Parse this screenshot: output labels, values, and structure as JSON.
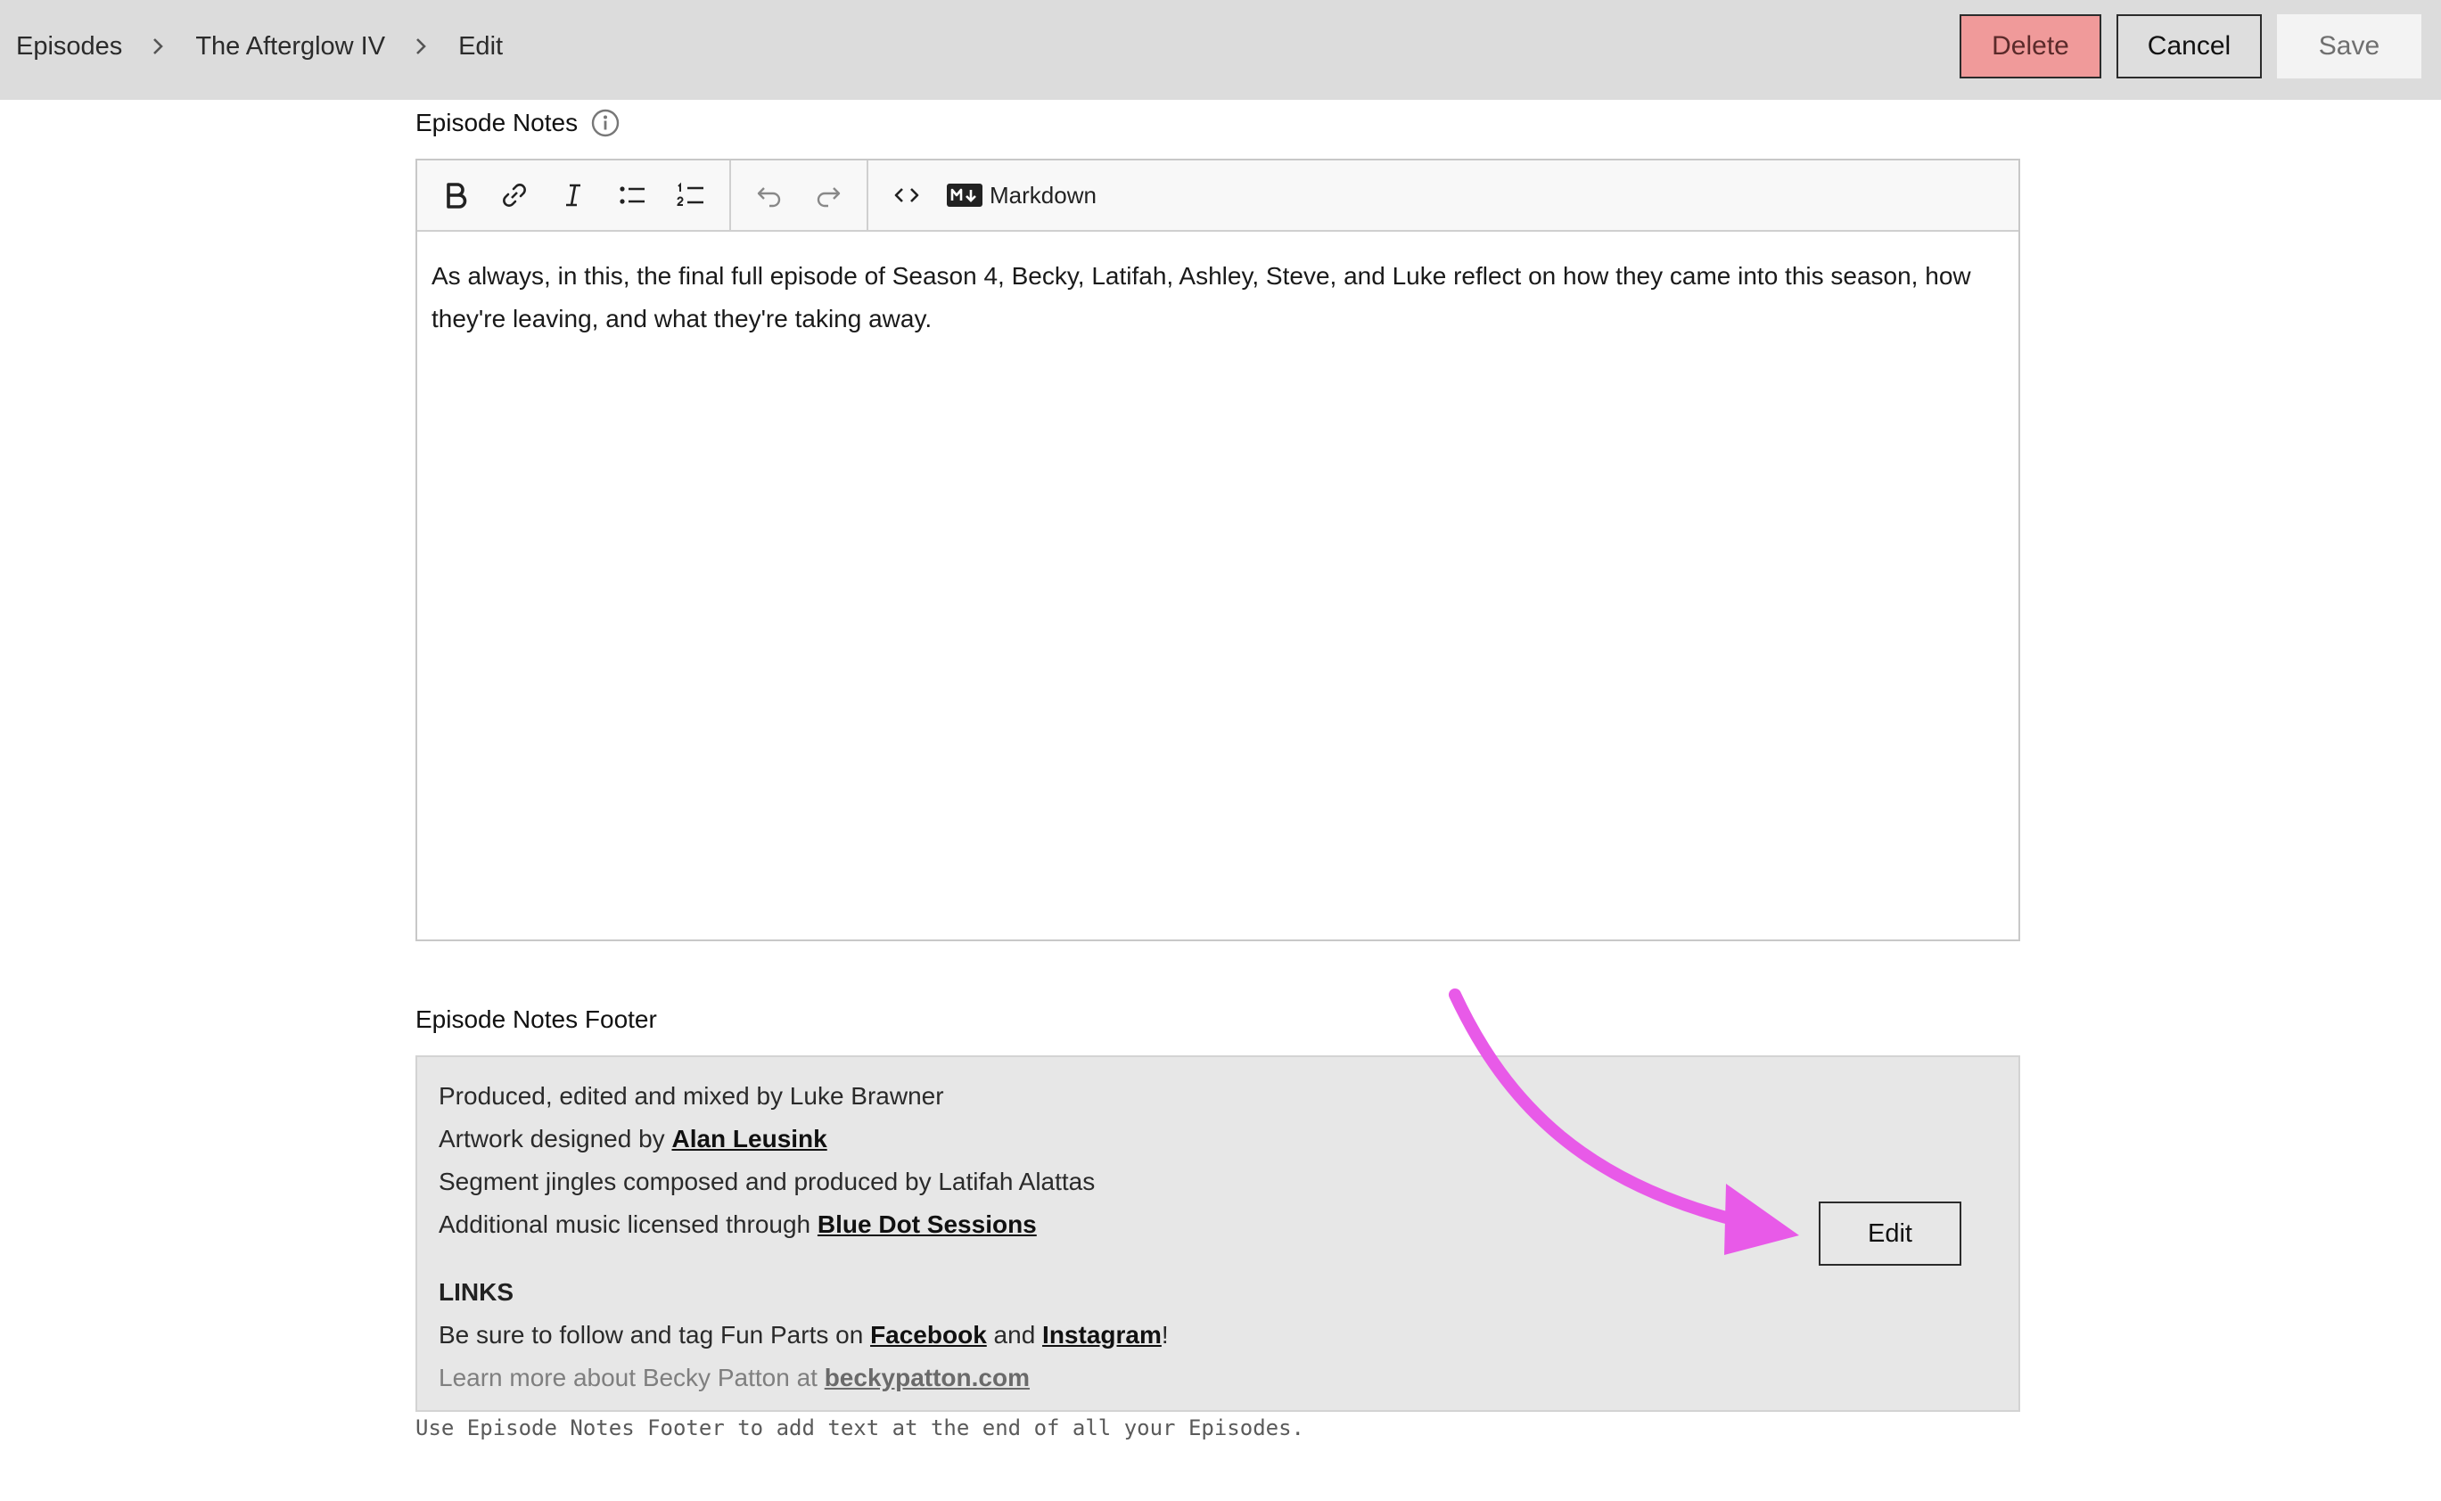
{
  "breadcrumb": {
    "items": [
      "Episodes",
      "The Afterglow IV",
      "Edit"
    ]
  },
  "actions": {
    "delete_label": "Delete",
    "cancel_label": "Cancel",
    "save_label": "Save"
  },
  "notes": {
    "label": "Episode Notes",
    "markdown_label": "Markdown",
    "body": "As always, in this, the final full episode of Season 4, Becky, Latifah, Ashley, Steve, and Luke reflect on how they came into this season, how they're leaving, and what they're taking away."
  },
  "footer": {
    "label": "Episode Notes Footer",
    "line1": "Produced, edited and mixed by Luke Brawner",
    "line2_prefix": "Artwork designed by ",
    "line2_link": "Alan Leusink",
    "line3": "Segment jingles composed and produced by Latifah Alattas",
    "line4_prefix": "Additional music licensed through ",
    "line4_link": "Blue Dot Sessions",
    "links_heading": "LINKS",
    "line5_prefix": "Be sure to follow and tag Fun Parts on ",
    "line5_link1": "Facebook",
    "line5_mid": " and ",
    "line5_link2": "Instagram",
    "line5_suffix": "!",
    "line6_prefix": "Learn more about Becky Patton at ",
    "line6_link": "beckypatton.com",
    "edit_label": "Edit",
    "hint": "Use Episode Notes Footer to add text at the end of all your Episodes."
  },
  "colors": {
    "topbar": "#dcdcdc",
    "delete_bg": "#f09a9a",
    "annotation_arrow": "#e85ae8"
  },
  "icons": [
    "chevron-right-icon",
    "info-icon",
    "bold-icon",
    "link-icon",
    "italic-icon",
    "bullet-list-icon",
    "numbered-list-icon",
    "undo-icon",
    "redo-icon",
    "code-icon",
    "markdown-icon",
    "arrow-annotation-icon"
  ]
}
